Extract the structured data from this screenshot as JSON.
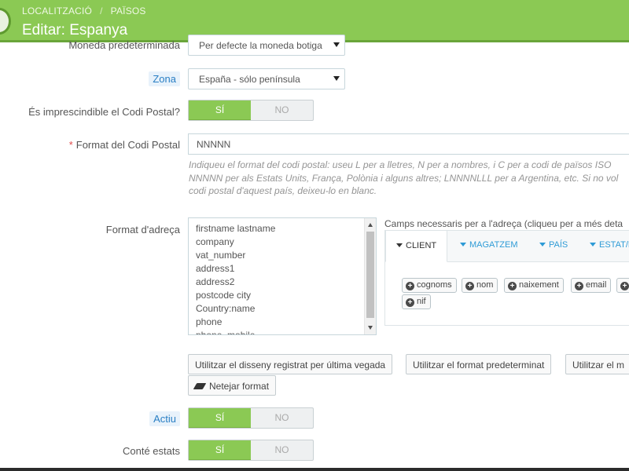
{
  "header": {
    "breadcrumb": [
      "LOCALITZACIÓ",
      "PAÏSOS"
    ],
    "breadcrumb_sep": "/",
    "title": "Editar: Espanya"
  },
  "form": {
    "currency": {
      "label": "Moneda predeterminada",
      "value": "Per defecte la moneda botiga"
    },
    "zone": {
      "label": "Zona",
      "value": "España - sólo península"
    },
    "need_zip": {
      "label": "És imprescindible el Codi Postal?",
      "yes": "SÍ",
      "no": "NO",
      "selected": "yes"
    },
    "zip_format": {
      "label": "Format del Codi Postal",
      "required_mark": "*",
      "value": "NNNNN",
      "help": [
        "Indiqueu el format del codi postal: useu L per a lletres, N per a nombres, i C per a codi de països ISO",
        "NNNNN per als Estats Units, França, Polònia i alguns altres; LNNNNLLL per a Argentina, etc. Si no vol",
        "codi postal d'aquest país, deixeu-lo en blanc."
      ]
    },
    "address_format": {
      "label": "Format d'adreça",
      "lines": [
        "firstname lastname",
        "company",
        "vat_number",
        "address1",
        "address2",
        "postcode city",
        "Country:name",
        "phone",
        "phone_mobile"
      ],
      "fields_title": "Camps necessaris per a l'adreça (cliqueu per a més deta",
      "tabs": [
        "CLIENT",
        "MAGATZEM",
        "PAÍS",
        "ESTAT/P"
      ],
      "active_tab": "CLIENT",
      "fields": [
        "cognoms",
        "nom",
        "naixement",
        "email",
        "",
        "nif"
      ],
      "buttons": {
        "last_saved": "Utilitzar el disseny registrat per última vegada",
        "default": "Utilitzar el format predeterminat",
        "current": "Utilitzar el m",
        "clear": "Netejar format"
      }
    },
    "active": {
      "label": "Actiu",
      "yes": "SÍ",
      "no": "NO",
      "selected": "yes"
    },
    "contains_states": {
      "label": "Conté estats",
      "yes": "SÍ",
      "no": "NO",
      "selected": "yes"
    }
  },
  "colors": {
    "header": "#8bc954",
    "toggle_on": "#8bc954",
    "link": "#2e9bd6",
    "required": "#e04b4b"
  }
}
